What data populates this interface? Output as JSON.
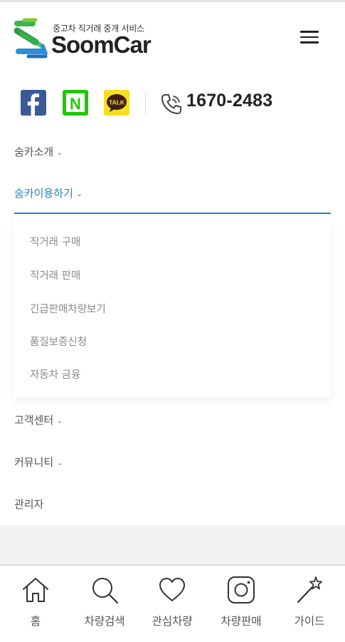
{
  "header": {
    "tagline": "중고차 직거래 중개 서비스",
    "brand": "SoomCar"
  },
  "contact": {
    "phone": "1670-2483",
    "naver_letter": "N",
    "kakao_letter": "TALK"
  },
  "nav": {
    "items": [
      {
        "label": "숨카소개"
      },
      {
        "label": "숨카이용하기"
      },
      {
        "label": "고객센터"
      },
      {
        "label": "커뮤니티"
      },
      {
        "label": "관리자"
      }
    ],
    "submenu": [
      {
        "label": "직거래 구매"
      },
      {
        "label": "직거래 판매"
      },
      {
        "label": "긴급판매차량보기"
      },
      {
        "label": "품질보증신청"
      },
      {
        "label": "자동차 금융"
      }
    ],
    "chevron": "⌄"
  },
  "bottom_nav": [
    {
      "label": "홈",
      "icon": "home-icon"
    },
    {
      "label": "차량검색",
      "icon": "search-icon"
    },
    {
      "label": "관심차량",
      "icon": "heart-icon"
    },
    {
      "label": "차량판매",
      "icon": "instagram-icon"
    },
    {
      "label": "가이드",
      "icon": "magic-wand-icon"
    }
  ],
  "colors": {
    "accent": "#2a7fc4",
    "logo_green": "#3ab54a",
    "logo_blue": "#2b8fd6",
    "facebook": "#3b5998",
    "naver": "#1ec800",
    "kakao": "#f7df1e"
  }
}
